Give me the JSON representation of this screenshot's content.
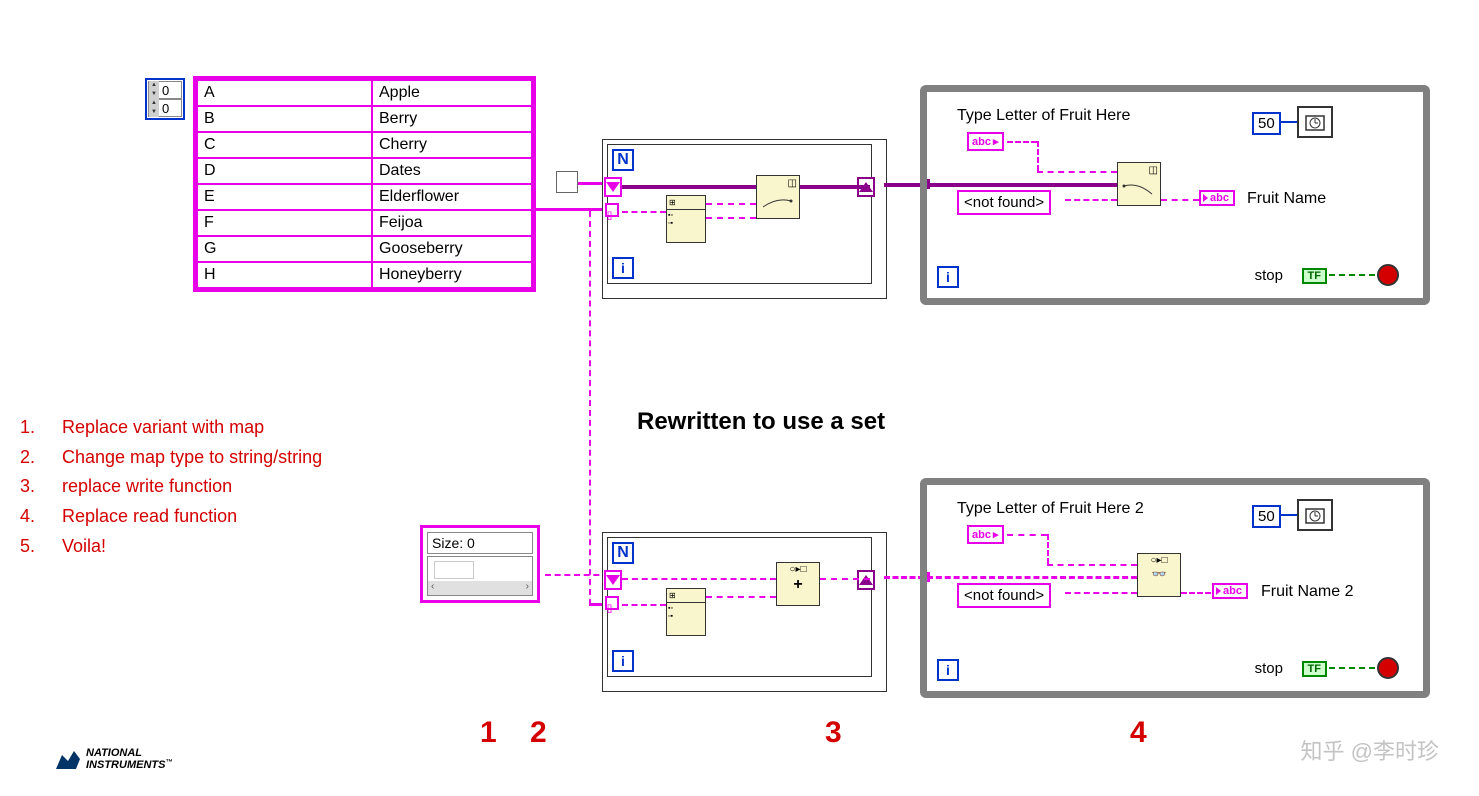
{
  "array_indices": [
    "0",
    "0"
  ],
  "fruit_table": [
    {
      "key": "A",
      "val": "Apple"
    },
    {
      "key": "B",
      "val": "Berry"
    },
    {
      "key": "C",
      "val": "Cherry"
    },
    {
      "key": "D",
      "val": "Dates"
    },
    {
      "key": "E",
      "val": "Elderflower"
    },
    {
      "key": "F",
      "val": "Feijoa"
    },
    {
      "key": "G",
      "val": "Gooseberry"
    },
    {
      "key": "H",
      "val": "Honeyberry"
    }
  ],
  "instructions": [
    "Replace variant with map",
    "Change map type to string/string",
    "replace write function",
    "Replace read function",
    "Voila!"
  ],
  "heading": "Rewritten to use a set",
  "loop": {
    "N": "N",
    "i": "i"
  },
  "size_label": "Size: 0",
  "while1": {
    "ctrl_label": "Type Letter of Fruit Here",
    "ctrl_abc": "abc",
    "not_found": "<not found>",
    "ind_abc": "abc",
    "ind_label": "Fruit Name",
    "wait": "50",
    "stop": "stop",
    "tf": "TF"
  },
  "while2": {
    "ctrl_label": "Type Letter of Fruit Here 2",
    "ctrl_abc": "abc",
    "not_found": "<not found>",
    "ind_abc": "abc",
    "ind_label": "Fruit Name 2",
    "wait": "50",
    "stop": "stop",
    "tf": "TF"
  },
  "red_marks": [
    "1",
    "2",
    "3",
    "4"
  ],
  "logo": {
    "line1": "NATIONAL",
    "line2": "INSTRUMENTS",
    "tm": "™"
  },
  "watermark": "知乎 @李时珍"
}
